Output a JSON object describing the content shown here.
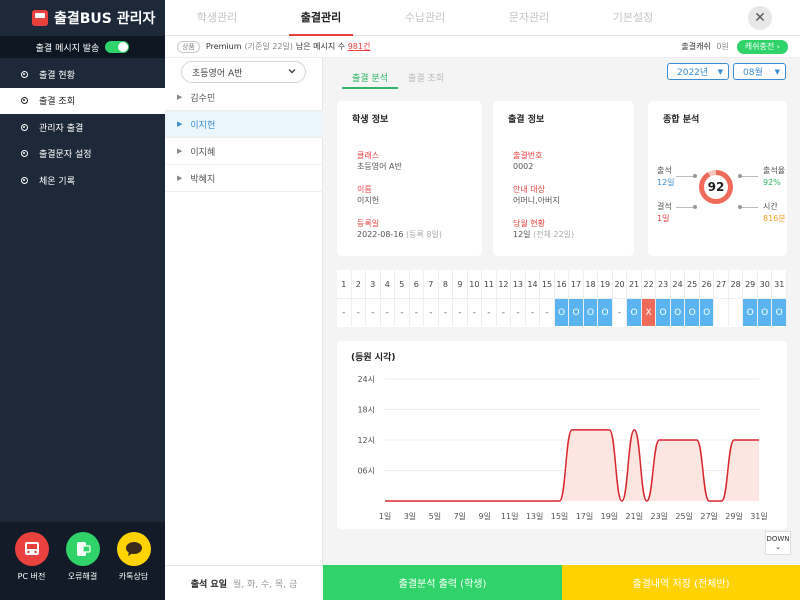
{
  "app": {
    "title": "출결BUS 관리자"
  },
  "sidebar": {
    "toggle_label": "출결 메시지 발송",
    "items": [
      {
        "label": "출결 현황",
        "active": false
      },
      {
        "label": "출결 조회",
        "active": true
      },
      {
        "label": "관리자 출결",
        "active": false
      },
      {
        "label": "출결문자 설정",
        "active": false
      },
      {
        "label": "체온 기록",
        "active": false
      }
    ],
    "bottom": [
      {
        "label": "PC 버전",
        "color": "#e8413e",
        "icon": "bus-icon"
      },
      {
        "label": "오류해결",
        "color": "#2fd36a",
        "icon": "phone-icon"
      },
      {
        "label": "카톡상담",
        "color": "#ffd200",
        "icon": "chat-icon"
      }
    ]
  },
  "nav": {
    "tabs": [
      {
        "label": "학생관리",
        "active": false
      },
      {
        "label": "출결관리",
        "active": true
      },
      {
        "label": "수납관리",
        "active": false
      },
      {
        "label": "문자관리",
        "active": false
      },
      {
        "label": "기본설정",
        "active": false
      }
    ],
    "close_icon": "✕"
  },
  "infobar": {
    "badge": "상품",
    "plan": "Premium",
    "plan_note": "(기준일 22일)",
    "remaining_label": "남은 메시지 수",
    "remaining_value": "981건",
    "cash_label": "출결캐쉬",
    "cash_value": "0원",
    "charge_button": "캐쉬충전"
  },
  "students": {
    "class_select": "초등영어 A반",
    "list": [
      {
        "name": "김수민",
        "active": false
      },
      {
        "name": "이지헌",
        "active": true
      },
      {
        "name": "이지혜",
        "active": false
      },
      {
        "name": "박혜지",
        "active": false
      }
    ],
    "footer_label": "출석 요일",
    "footer_days": "월, 화, 수, 목, 금"
  },
  "main": {
    "subtabs": [
      "출결 분석",
      "출결 조회"
    ],
    "year": "2022년",
    "month": "08월",
    "student_info": {
      "title": "학생 정보",
      "class_label": "클래스",
      "class_value": "초등영어 A반",
      "name_label": "이름",
      "name_value": "이지헌",
      "reg_label": "등록일",
      "reg_value": "2022-08-16",
      "reg_note": "(등록 8일)"
    },
    "attend_info": {
      "title": "출결 정보",
      "no_label": "출결번호",
      "no_value": "0002",
      "target_label": "안내 대상",
      "target_value": "어머니,아버지",
      "month_label": "당월 현황",
      "month_value": "12일",
      "month_note": "(전체 22일)"
    },
    "summary": {
      "title": "종합 분석",
      "score": "92",
      "attend_label": "출석",
      "attend_value": "12일",
      "attend_color": "#3a8dd1",
      "absent_label": "결석",
      "absent_value": "1일",
      "absent_color": "#e8413e",
      "rate_label": "출석율",
      "rate_value": "92%",
      "rate_color": "#2fb567",
      "time_label": "시간",
      "time_value": "816분",
      "time_color": "#f0a020"
    },
    "calendar": {
      "days": [
        "1",
        "2",
        "3",
        "4",
        "5",
        "6",
        "7",
        "8",
        "9",
        "10",
        "11",
        "12",
        "13",
        "14",
        "15",
        "16",
        "17",
        "18",
        "19",
        "20",
        "21",
        "22",
        "23",
        "24",
        "25",
        "26",
        "27",
        "28",
        "29",
        "30",
        "31"
      ],
      "marks": [
        "-",
        "-",
        "-",
        "-",
        "-",
        "-",
        "-",
        "-",
        "-",
        "-",
        "-",
        "-",
        "-",
        "-",
        "-",
        "O",
        "O",
        "O",
        "O",
        "-",
        "O",
        "X",
        "O",
        "O",
        "O",
        "O",
        "",
        "",
        "O",
        "O",
        "O"
      ]
    },
    "down_label": "DOWN"
  },
  "chart_data": {
    "type": "area",
    "title": "(등원 시각)",
    "x": [
      "1일",
      "3일",
      "5일",
      "7일",
      "9일",
      "11일",
      "13일",
      "15일",
      "17일",
      "19일",
      "21일",
      "23일",
      "25일",
      "27일",
      "29일",
      "31일"
    ],
    "y_ticks": [
      "24시",
      "18시",
      "12시",
      "06시"
    ],
    "ylim": [
      0,
      24
    ],
    "days": [
      1,
      2,
      3,
      4,
      5,
      6,
      7,
      8,
      9,
      10,
      11,
      12,
      13,
      14,
      15,
      16,
      17,
      18,
      19,
      20,
      21,
      22,
      23,
      24,
      25,
      26,
      27,
      28,
      29,
      30,
      31
    ],
    "values": [
      0,
      0,
      0,
      0,
      0,
      0,
      0,
      0,
      0,
      0,
      0,
      0,
      0,
      0,
      0,
      14,
      14,
      14,
      14,
      0,
      14,
      0,
      12,
      12,
      12,
      12,
      0,
      0,
      12,
      12,
      12
    ],
    "color": "#d9272e",
    "fill": "#fde5e2"
  },
  "buttons": {
    "export_student": "출결분석 출력 (학생)",
    "save_all": "출결내역 저장 (전체반)"
  }
}
